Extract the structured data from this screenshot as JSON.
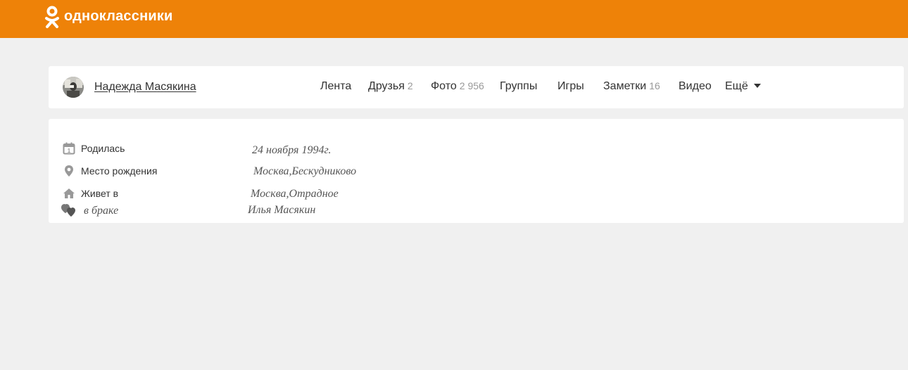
{
  "header": {
    "brand": "одноклассники",
    "brand_color": "#ee8208"
  },
  "profile": {
    "name": "Надежда Масякина",
    "nav": [
      {
        "label": "Лента",
        "count": ""
      },
      {
        "label": "Друзья",
        "count": "2"
      },
      {
        "label": "Фото",
        "count": "2 956"
      },
      {
        "label": "Группы",
        "count": ""
      },
      {
        "label": "Игры",
        "count": ""
      },
      {
        "label": "Заметки",
        "count": "16"
      },
      {
        "label": "Видео",
        "count": ""
      },
      {
        "label": "Ещё",
        "count": ""
      }
    ]
  },
  "info": {
    "birth": {
      "label": "Родилась",
      "value": "24 ноября 1994г.",
      "icon": "calendar-icon"
    },
    "birthplace": {
      "label": "Место рождения",
      "value": "Москва,Бескудниково",
      "icon": "location-pin-icon"
    },
    "lives": {
      "label": "Живет в",
      "value": "Москва,Отрадное",
      "icon": "home-icon"
    },
    "married": {
      "label": "в браке",
      "value": "Илья Масякин",
      "icon": "hearts-icon"
    }
  }
}
